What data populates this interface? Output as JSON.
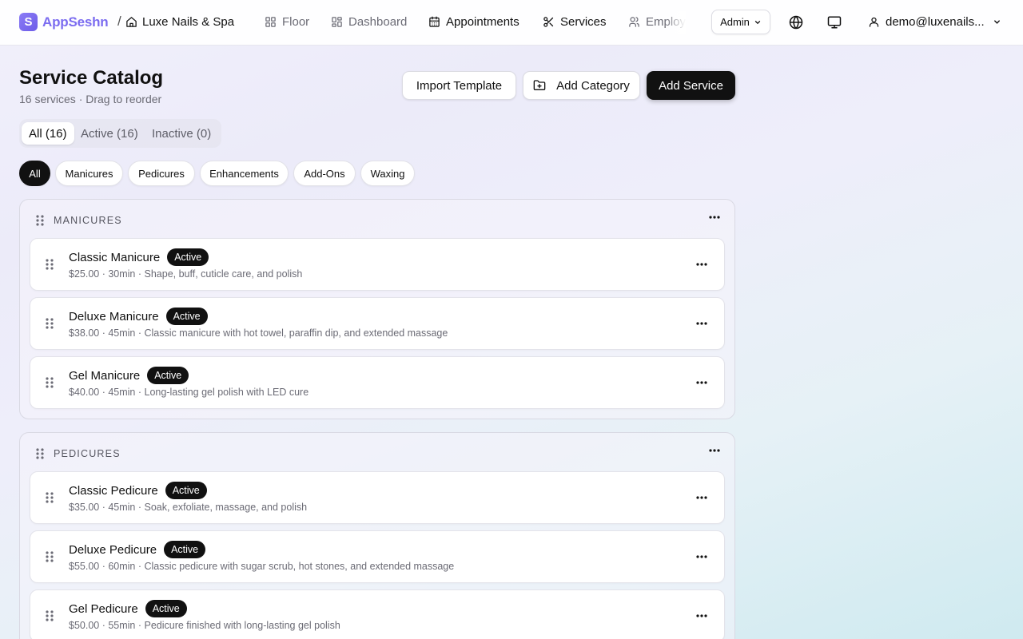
{
  "app": {
    "name": "AppSeshn",
    "logo_letter": "S",
    "accent": "#7b6cf0"
  },
  "breadcrumb": {
    "separator": "/",
    "location": "Luxe Nails & Spa"
  },
  "nav": {
    "floor": "Floor",
    "dashboard": "Dashboard",
    "appointments": "Appointments",
    "services": "Services",
    "employees": "Employees",
    "active_item": "Services"
  },
  "topbar": {
    "role": "Admin",
    "user_email": "demo@luxenails..."
  },
  "page": {
    "title": "Service Catalog",
    "subtitle": "16 services · Drag to reorder"
  },
  "actions": {
    "import": "Import Template",
    "add_category": "Add Category",
    "add_service": "Add Service"
  },
  "status_tabs": {
    "all": "All (16)",
    "active": "Active (16)",
    "inactive": "Inactive (0)",
    "selected": "All (16)"
  },
  "chips": {
    "all": "All",
    "manicures": "Manicures",
    "pedicures": "Pedicures",
    "enhancements": "Enhancements",
    "addons": "Add-Ons",
    "waxing": "Waxing",
    "selected": "All"
  },
  "categories": [
    {
      "title": "MANICURES",
      "services": [
        {
          "name": "Classic Manicure",
          "status": "Active",
          "meta": "$25.00 · 30min · Shape, buff, cuticle care, and polish"
        },
        {
          "name": "Deluxe Manicure",
          "status": "Active",
          "meta": "$38.00 · 45min · Classic manicure with hot towel, paraffin dip, and extended massage"
        },
        {
          "name": "Gel Manicure",
          "status": "Active",
          "meta": "$40.00 · 45min · Long-lasting gel polish with LED cure"
        }
      ]
    },
    {
      "title": "PEDICURES",
      "services": [
        {
          "name": "Classic Pedicure",
          "status": "Active",
          "meta": "$35.00 · 45min · Soak, exfoliate, massage, and polish"
        },
        {
          "name": "Deluxe Pedicure",
          "status": "Active",
          "meta": "$55.00 · 60min · Classic pedicure with sugar scrub, hot stones, and extended massage"
        },
        {
          "name": "Gel Pedicure",
          "status": "Active",
          "meta": "$50.00 · 55min · Pedicure finished with long-lasting gel polish"
        }
      ]
    }
  ],
  "icons": [
    "home-icon",
    "grid-icon",
    "calendar-icon",
    "scissors-icon",
    "users-icon",
    "chevron-down-icon",
    "globe-icon",
    "monitor-icon",
    "user-icon",
    "folder-plus-icon",
    "grip-icon",
    "more-icon"
  ]
}
